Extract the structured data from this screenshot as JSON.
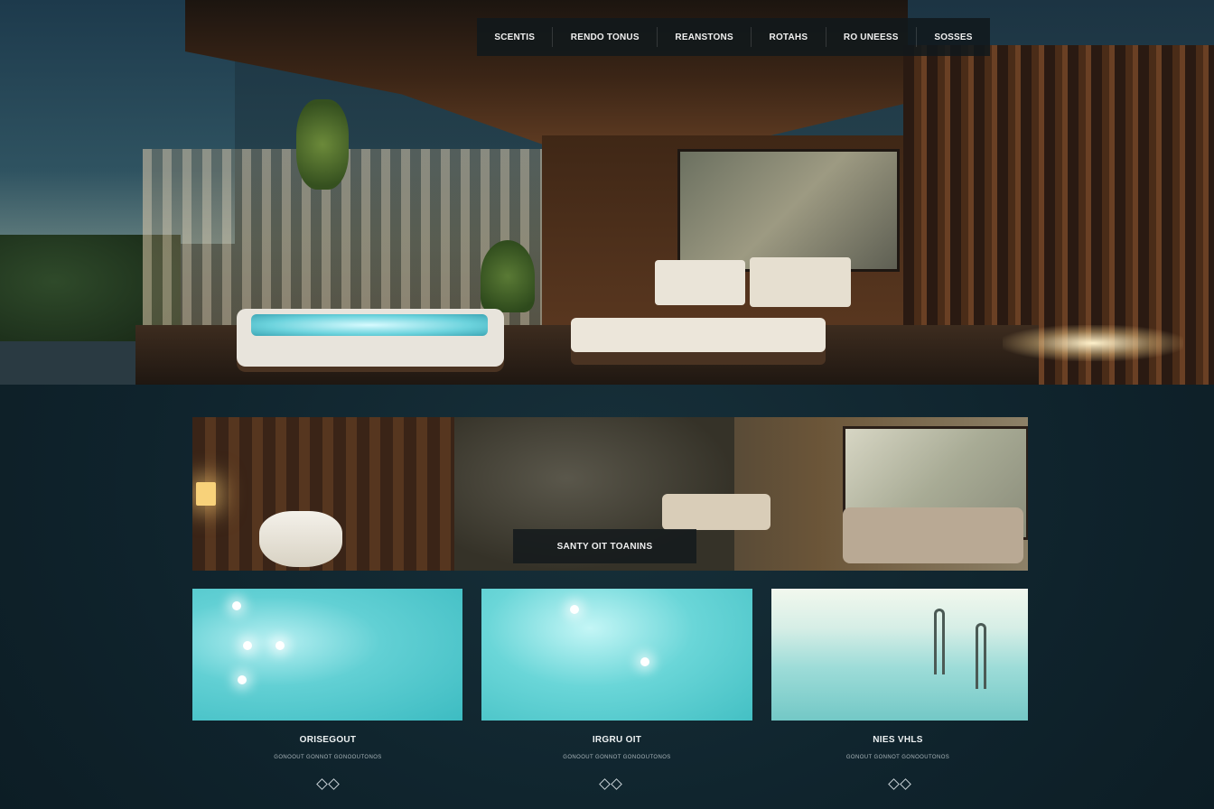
{
  "nav": {
    "items": [
      {
        "label": "SCENTIS"
      },
      {
        "label": "RENDO TONUS"
      },
      {
        "label": "REANSTONS"
      },
      {
        "label": "ROTAHS"
      },
      {
        "label": "RO UNEESS"
      },
      {
        "label": "SOSSES"
      }
    ]
  },
  "feature": {
    "caption": "SANTY OIT TOANINS"
  },
  "cards": [
    {
      "title": "ORISEGOUT",
      "desc": "GONOOUT GONNOT GONOOUTONOS"
    },
    {
      "title": "IRGRU OIT",
      "desc": "GONOOUT GONNOT GONOOUTONOS"
    },
    {
      "title": "NIES VHLS",
      "desc": "GONOUT GONNOT GONOOUTONOS"
    }
  ],
  "colors": {
    "page_bg": "#0f232c",
    "nav_bg": "#10181c",
    "pool_accent": "#62d0d4"
  }
}
